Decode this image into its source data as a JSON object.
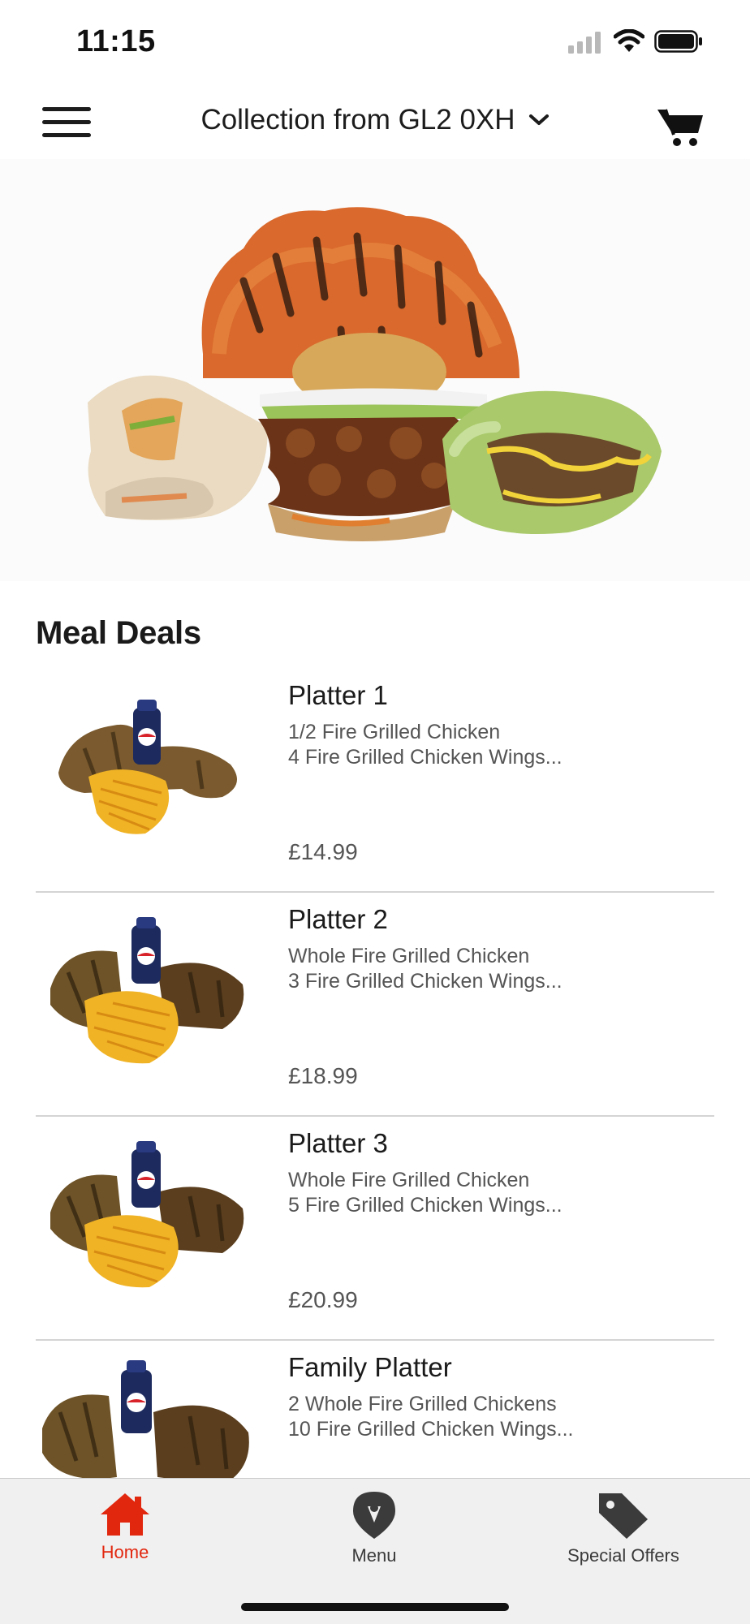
{
  "status_bar": {
    "time": "11:15"
  },
  "header": {
    "location_label": "Collection from GL2 0XH",
    "icons": {
      "menu": "hamburger-menu-icon",
      "dropdown": "chevron-down-icon",
      "cart": "cart-icon"
    }
  },
  "section": {
    "title": "Meal Deals"
  },
  "items": [
    {
      "title": "Platter 1",
      "desc_line1": "1/2 Fire Grilled Chicken",
      "desc_line2": "4 Fire Grilled Chicken Wings...",
      "price": "£14.99"
    },
    {
      "title": "Platter 2",
      "desc_line1": "Whole Fire Grilled Chicken",
      "desc_line2": "3 Fire Grilled Chicken Wings...",
      "price": "£18.99"
    },
    {
      "title": "Platter 3",
      "desc_line1": "Whole Fire Grilled Chicken",
      "desc_line2": "5 Fire Grilled Chicken Wings...",
      "price": "£20.99"
    },
    {
      "title": "Family Platter",
      "desc_line1": "2 Whole Fire Grilled Chickens",
      "desc_line2": "10 Fire Grilled Chicken Wings..."
    }
  ],
  "tabs": [
    {
      "label": "Home",
      "icon": "home-icon",
      "active": true
    },
    {
      "label": "Menu",
      "icon": "location-pin-icon",
      "active": false
    },
    {
      "label": "Special Offers",
      "icon": "tag-icon",
      "active": false
    }
  ],
  "colors": {
    "accent": "#e2270f",
    "tab_inactive": "#3a3a3a",
    "tabbar_bg": "#f0f0f0",
    "divider": "#d4d4d4"
  }
}
